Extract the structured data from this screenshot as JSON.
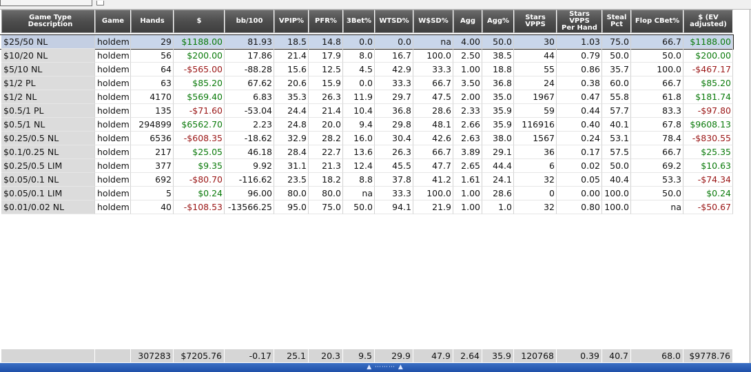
{
  "columns": [
    {
      "key": "desc",
      "label": "Game Type Description",
      "align": "left"
    },
    {
      "key": "game",
      "label": "Game",
      "align": "left"
    },
    {
      "key": "hands",
      "label": "Hands"
    },
    {
      "key": "dollar",
      "label": "$"
    },
    {
      "key": "bb100",
      "label": "bb/100"
    },
    {
      "key": "vpip",
      "label": "VPIP%"
    },
    {
      "key": "pfr",
      "label": "PFR%"
    },
    {
      "key": "threebet",
      "label": "3Bet%"
    },
    {
      "key": "wtsd",
      "label": "WTSD%"
    },
    {
      "key": "wsd",
      "label": "W$SD%"
    },
    {
      "key": "agg",
      "label": "Agg"
    },
    {
      "key": "aggp",
      "label": "Agg%"
    },
    {
      "key": "vpps",
      "label": "Stars\nVPPS"
    },
    {
      "key": "vppsph",
      "label": "Stars\nVPPS\nPer Hand"
    },
    {
      "key": "steal",
      "label": "Steal\nPct"
    },
    {
      "key": "cbet",
      "label": "Flop CBet%"
    },
    {
      "key": "ev",
      "label": "$ (EV\nadjusted)"
    }
  ],
  "rows": [
    [
      "$25/50 NL",
      "holdem",
      "29",
      "$1188.00",
      "81.93",
      "18.5",
      "14.8",
      "0.0",
      "0.0",
      "na",
      "4.00",
      "50.0",
      "30",
      "1.03",
      "75.0",
      "66.7",
      "$1188.00"
    ],
    [
      "$10/20 NL",
      "holdem",
      "56",
      "$200.00",
      "17.86",
      "21.4",
      "17.9",
      "8.0",
      "16.7",
      "100.0",
      "2.50",
      "38.5",
      "44",
      "0.79",
      "50.0",
      "50.0",
      "$200.00"
    ],
    [
      "$5/10 NL",
      "holdem",
      "64",
      "-$565.00",
      "-88.28",
      "15.6",
      "12.5",
      "4.5",
      "42.9",
      "33.3",
      "1.00",
      "18.8",
      "55",
      "0.86",
      "35.7",
      "100.0",
      "-$467.17"
    ],
    [
      "$1/2 PL",
      "holdem",
      "63",
      "$85.20",
      "67.62",
      "20.6",
      "15.9",
      "0.0",
      "33.3",
      "66.7",
      "3.50",
      "36.8",
      "24",
      "0.38",
      "60.0",
      "66.7",
      "$85.20"
    ],
    [
      "$1/2 NL",
      "holdem",
      "4170",
      "$569.40",
      "6.83",
      "35.3",
      "26.3",
      "11.9",
      "29.7",
      "47.5",
      "2.00",
      "35.0",
      "1967",
      "0.47",
      "55.8",
      "61.8",
      "$181.74"
    ],
    [
      "$0.5/1 PL",
      "holdem",
      "135",
      "-$71.60",
      "-53.04",
      "24.4",
      "21.4",
      "10.4",
      "36.8",
      "28.6",
      "2.33",
      "35.9",
      "59",
      "0.44",
      "57.7",
      "83.3",
      "-$97.80"
    ],
    [
      "$0.5/1 NL",
      "holdem",
      "294899",
      "$6562.70",
      "2.23",
      "24.8",
      "20.0",
      "9.4",
      "29.8",
      "48.1",
      "2.66",
      "35.9",
      "116916",
      "0.40",
      "40.1",
      "67.8",
      "$9608.13"
    ],
    [
      "$0.25/0.5 NL",
      "holdem",
      "6536",
      "-$608.35",
      "-18.62",
      "32.9",
      "28.2",
      "16.0",
      "30.4",
      "42.6",
      "2.63",
      "38.0",
      "1567",
      "0.24",
      "53.1",
      "78.4",
      "-$830.55"
    ],
    [
      "$0.1/0.25 NL",
      "holdem",
      "217",
      "$25.05",
      "46.18",
      "28.4",
      "22.7",
      "13.6",
      "26.3",
      "66.7",
      "3.89",
      "29.1",
      "36",
      "0.17",
      "57.5",
      "66.7",
      "$25.35"
    ],
    [
      "$0.25/0.5 LIM",
      "holdem",
      "377",
      "$9.35",
      "9.92",
      "31.1",
      "21.3",
      "12.4",
      "45.5",
      "47.7",
      "2.65",
      "44.4",
      "6",
      "0.02",
      "50.0",
      "69.2",
      "$10.63"
    ],
    [
      "$0.05/0.1 NL",
      "holdem",
      "692",
      "-$80.70",
      "-116.62",
      "23.5",
      "18.2",
      "8.8",
      "37.8",
      "41.2",
      "1.61",
      "24.1",
      "32",
      "0.05",
      "40.4",
      "53.3",
      "-$74.34"
    ],
    [
      "$0.05/0.1 LIM",
      "holdem",
      "5",
      "$0.24",
      "96.00",
      "80.0",
      "80.0",
      "na",
      "33.3",
      "100.0",
      "1.00",
      "28.6",
      "0",
      "0.00",
      "100.0",
      "50.0",
      "$0.24"
    ],
    [
      "$0.01/0.02 NL",
      "holdem",
      "40",
      "-$108.53",
      "-13566.25",
      "95.0",
      "75.0",
      "50.0",
      "94.1",
      "21.9",
      "1.00",
      "1.0",
      "32",
      "0.80",
      "100.0",
      "na",
      "-$50.67"
    ]
  ],
  "totals": [
    "",
    "",
    "307283",
    "$7205.76",
    "-0.17",
    "25.1",
    "20.3",
    "9.5",
    "29.9",
    "47.9",
    "2.64",
    "35.9",
    "120768",
    "0.39",
    "40.7",
    "68.0",
    "$9778.76"
  ],
  "colors": {
    "positive": "#0a7a0a",
    "negative": "#9a1515",
    "selected_row": "#c9d6ea",
    "header": "#4d4d4d",
    "statusbar": "#2a5db8"
  },
  "selected_row_index": 0
}
